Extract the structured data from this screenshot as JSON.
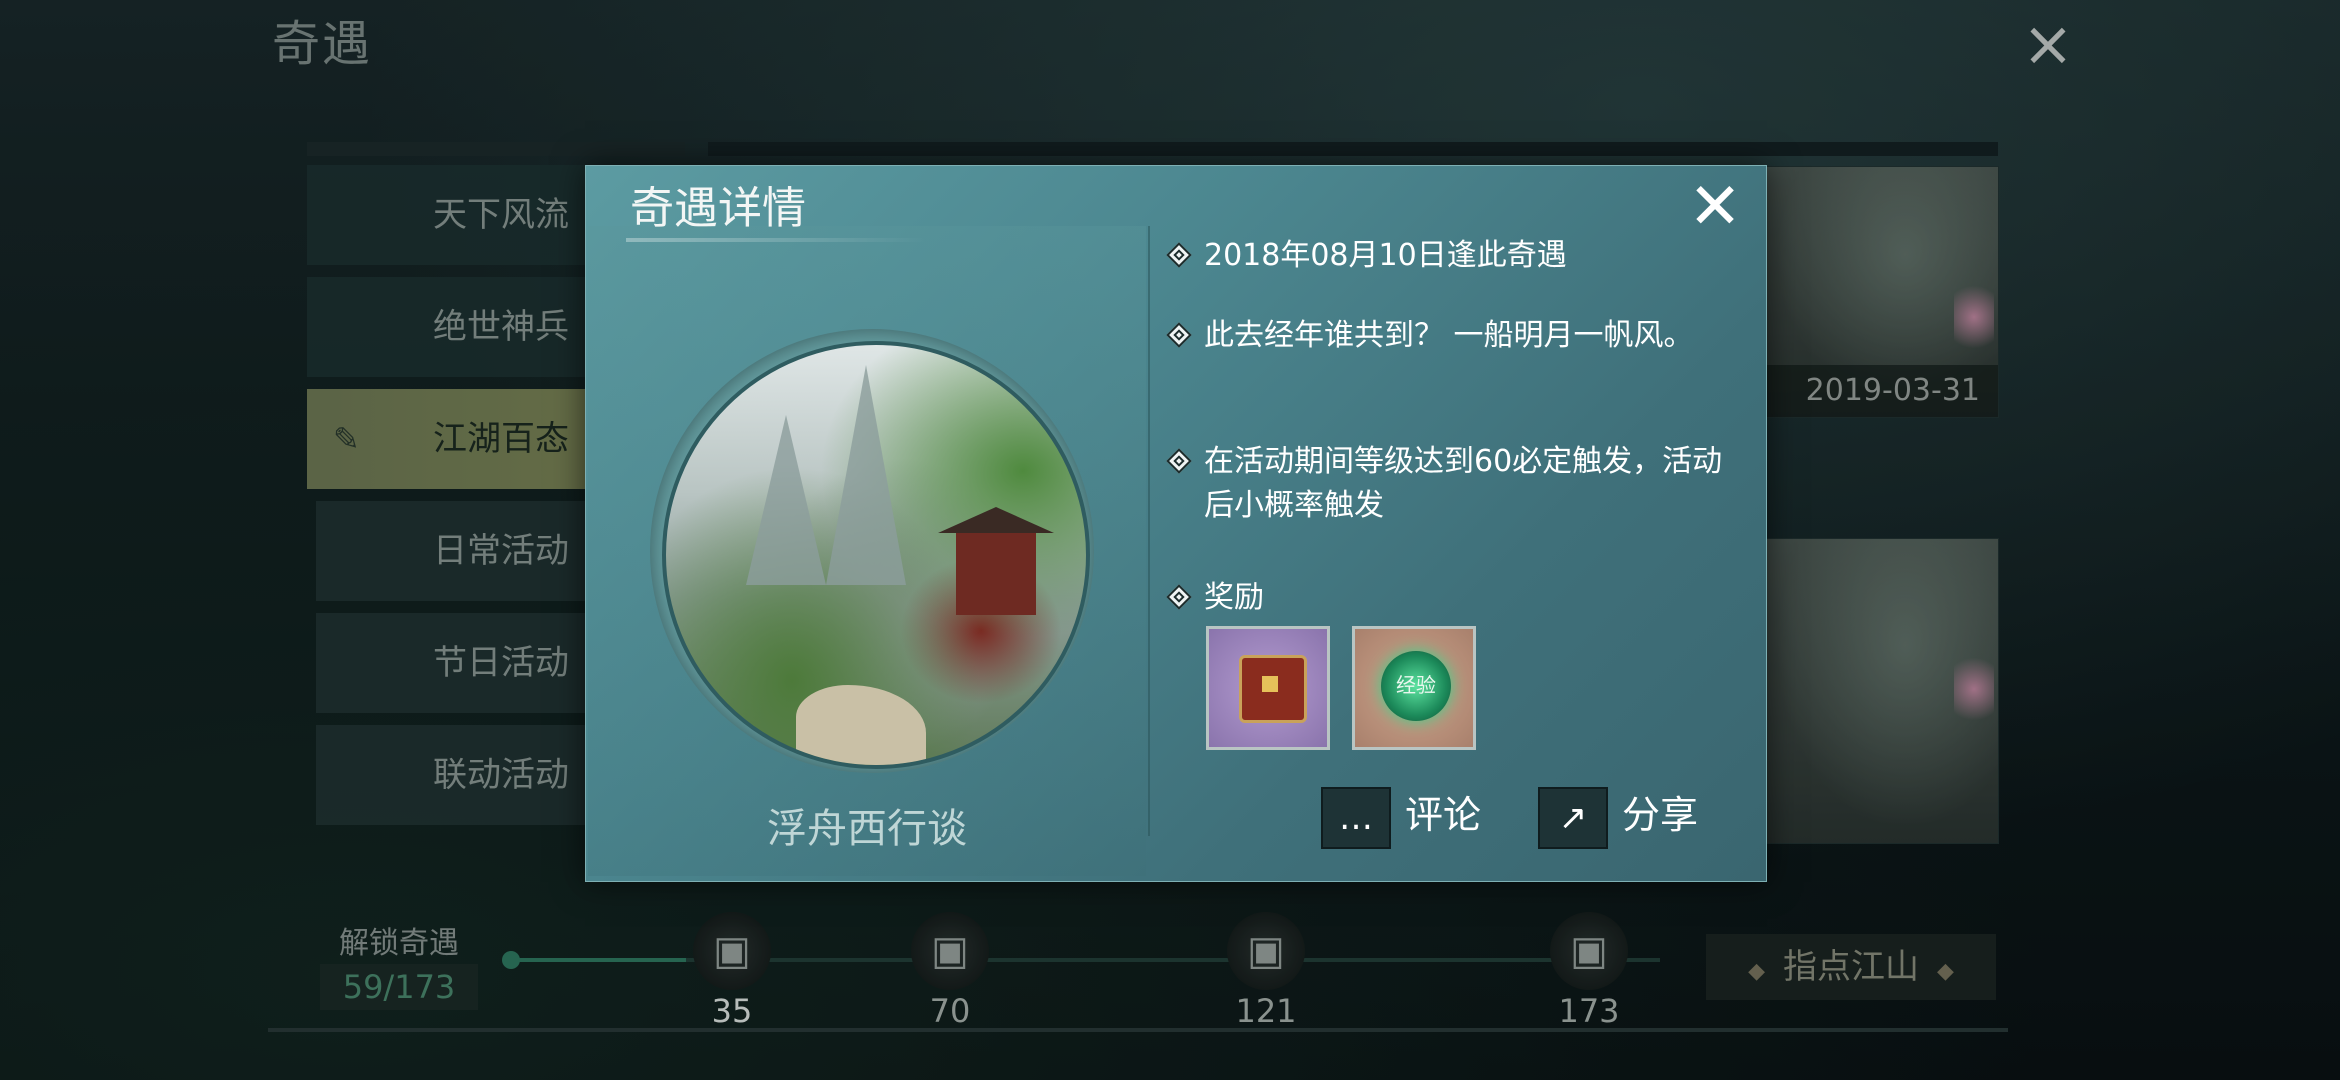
{
  "page": {
    "title": "奇遇",
    "close_icon": "close-icon"
  },
  "sidebar": {
    "items": [
      {
        "label": "天下风流",
        "active": false
      },
      {
        "label": "绝世神兵",
        "active": false
      },
      {
        "label": "江湖百态",
        "active": true
      },
      {
        "label": "日常活动",
        "active": false
      },
      {
        "label": "节日活动",
        "active": false
      },
      {
        "label": "联动活动",
        "active": false
      }
    ]
  },
  "thumbnails": [
    {
      "date": "2019-03-31"
    },
    {
      "date": ""
    }
  ],
  "progress": {
    "label": "解锁奇遇",
    "count": "59/173",
    "unlocked": 59,
    "total": 173,
    "milestones": [
      {
        "value": "35",
        "icon": "chest-icon"
      },
      {
        "value": "70",
        "icon": "chest-icon"
      },
      {
        "value": "121",
        "icon": "chest-icon"
      },
      {
        "value": "173",
        "icon": "chest-icon"
      }
    ],
    "guide_button": "指点江山"
  },
  "modal": {
    "title": "奇遇详情",
    "encounter_name": "浮舟西行谈",
    "date_line": "2018年08月10日逢此奇遇",
    "poem": "此去经年谁共到？ 一船明月一帆风。",
    "condition": "在活动期间等级达到60必定触发，活动后小概率触发",
    "rewards_label": "奖励",
    "rewards": [
      {
        "icon": "treasure-chest-icon"
      },
      {
        "icon": "experience-orb-icon",
        "text": "经验"
      }
    ],
    "comment_label": "评论",
    "share_label": "分享"
  },
  "colors": {
    "modal_bg": "#4c8790",
    "active_tab": "#7a8456",
    "progress_fill": "#2f7a62"
  }
}
